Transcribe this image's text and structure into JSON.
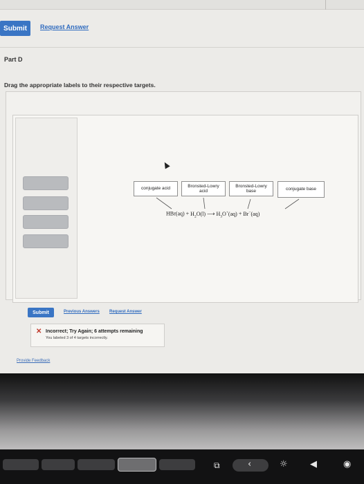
{
  "top": {
    "submit_label": "Submit",
    "request_answer_label": "Request Answer"
  },
  "part": {
    "title": "Part D",
    "instruction": "Drag the appropriate labels to their respective targets."
  },
  "targets": [
    {
      "label": "conjugate acid"
    },
    {
      "label": "Bronsted-Lowry\nacid"
    },
    {
      "label": "Bronsted-Lowry\nbase"
    },
    {
      "label": "conjugate base"
    }
  ],
  "equation": {
    "reactant1": "HBr(aq)",
    "plus1": "+",
    "reactant2_pre": "H",
    "reactant2_sub": "2",
    "reactant2_post": "O(l)",
    "arrow": "⟶",
    "product1_pre": "H",
    "product1_sub": "3",
    "product1_mid": "O",
    "product1_sup": "+",
    "product1_post": "(aq)",
    "plus2": "+",
    "product2_pre": "Br",
    "product2_sup": "−",
    "product2_post": "(aq)"
  },
  "bottom": {
    "submit_label": "Submit",
    "previous_answers_label": "Previous Answers",
    "request_answer_label": "Request Answer"
  },
  "feedback": {
    "title": "Incorrect; Try Again; 6 attempts remaining",
    "message": "You labeled 3 of 4 targets incorrectly."
  },
  "provide_feedback_label": "Provide Feedback",
  "icons": {
    "incorrect": "x-mark",
    "touchbar_screenshot": "screenshot-icon",
    "touchbar_chevron": "chevron-left-icon",
    "touchbar_brightness": "brightness-icon",
    "touchbar_volume": "volume-icon",
    "touchbar_siri": "siri-icon"
  },
  "colors": {
    "accent": "#3a75c4",
    "error": "#c0392b"
  }
}
